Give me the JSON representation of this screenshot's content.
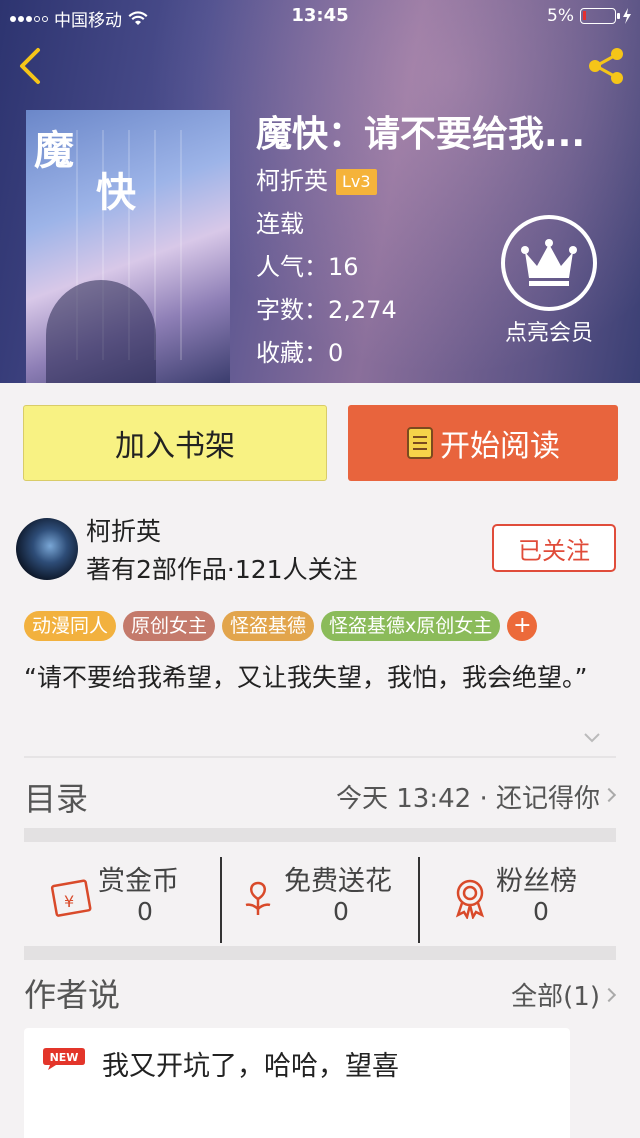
{
  "status_bar": {
    "carrier": "中国移动",
    "time": "13:45",
    "battery": "5%"
  },
  "book": {
    "title": "魔快：请不要给我...",
    "cover_title_1": "魔",
    "cover_title_2": "快",
    "author": "柯折英",
    "level": "Lv3",
    "status": "连载",
    "popularity_label": "人气：",
    "popularity": "16",
    "words_label": "字数：",
    "words": "2,274",
    "favorites_label": "收藏：",
    "favorites": "0"
  },
  "vip": {
    "label": "点亮会员"
  },
  "actions": {
    "add_shelf": "加入书架",
    "start_read": "开始阅读"
  },
  "author_info": {
    "name": "柯折英",
    "stats": "著有2部作品·121人关注",
    "follow_label": "已关注"
  },
  "tags": [
    {
      "label": "动漫同人",
      "color": "#f2b13e"
    },
    {
      "label": "原创女主",
      "color": "#c47a6b"
    },
    {
      "label": "怪盗基德",
      "color": "#e2a54c"
    },
    {
      "label": "怪盗基德x原创女主",
      "color": "#8bbb5a"
    }
  ],
  "tag_more": "+",
  "quote": "“请不要给我希望，又让我失望，我怕，我会绝望。”",
  "toc": {
    "title": "目录",
    "latest": "今天 13:42 · 还记得你"
  },
  "rewards": [
    {
      "label": "赏金币",
      "value": "0",
      "icon": "red-envelope-icon"
    },
    {
      "label": "免费送花",
      "value": "0",
      "icon": "flower-icon"
    },
    {
      "label": "粉丝榜",
      "value": "0",
      "icon": "medal-icon"
    }
  ],
  "author_say": {
    "title": "作者说",
    "all_label": "全部(1)"
  },
  "message": {
    "badge": "NEW",
    "text": "我又开坑了，哈哈，望喜"
  },
  "colors": {
    "accent": "#e8643d",
    "shelf": "#f8f283",
    "follow": "#e04c3a"
  }
}
